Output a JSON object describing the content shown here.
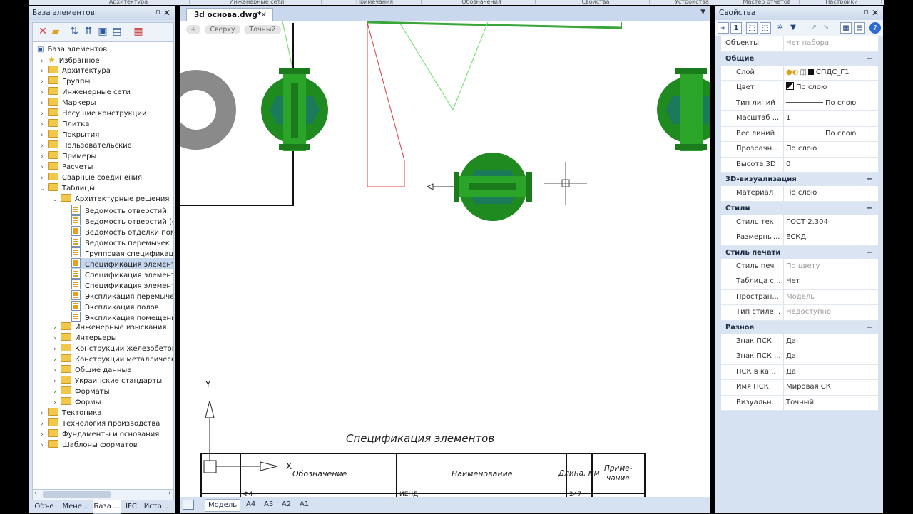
{
  "ribbon_tabs": [
    "Архитектура",
    "Инженерные сети",
    "Примечания",
    "Обозначения",
    "Свойства",
    "Устройства",
    "Мастер отчётов",
    "Настройки"
  ],
  "left_panel": {
    "title": "База элементов",
    "pin": "ᵖ",
    "close": "✕",
    "tree": [
      {
        "label": "База элементов",
        "level": 0,
        "icon": "db",
        "exp": ""
      },
      {
        "label": "Избранное",
        "level": 1,
        "icon": "star",
        "exp": ">"
      },
      {
        "label": "Архитектура",
        "level": 1,
        "icon": "folder",
        "exp": ">"
      },
      {
        "label": "Группы",
        "level": 1,
        "icon": "folder",
        "exp": ">"
      },
      {
        "label": "Инженерные сети",
        "level": 1,
        "icon": "folder",
        "exp": ">"
      },
      {
        "label": "Маркеры",
        "level": 1,
        "icon": "folder",
        "exp": ">"
      },
      {
        "label": "Несущие конструкции",
        "level": 1,
        "icon": "folder",
        "exp": ">"
      },
      {
        "label": "Плитка",
        "level": 1,
        "icon": "folder",
        "exp": ">"
      },
      {
        "label": "Покрытия",
        "level": 1,
        "icon": "folder",
        "exp": ">"
      },
      {
        "label": "Пользовательские",
        "level": 1,
        "icon": "folder",
        "exp": ">"
      },
      {
        "label": "Примеры",
        "level": 1,
        "icon": "folder",
        "exp": ">"
      },
      {
        "label": "Расчеты",
        "level": 1,
        "icon": "folder",
        "exp": ">"
      },
      {
        "label": "Сварные соединения",
        "level": 1,
        "icon": "folder",
        "exp": ">"
      },
      {
        "label": "Таблицы",
        "level": 1,
        "icon": "folder",
        "exp": "v"
      },
      {
        "label": "Архитектурные решения",
        "level": 2,
        "icon": "folder",
        "exp": "v"
      },
      {
        "label": "Ведомость отверстий",
        "level": 3,
        "icon": "table",
        "exp": ""
      },
      {
        "label": "Ведомость отверстий (с",
        "level": 3,
        "icon": "table",
        "exp": ""
      },
      {
        "label": "Ведомость отделки поме",
        "level": 3,
        "icon": "table",
        "exp": ""
      },
      {
        "label": "Ведомость перемычек",
        "level": 3,
        "icon": "table",
        "exp": ""
      },
      {
        "label": "Групповая спецификаци",
        "level": 3,
        "icon": "table",
        "exp": ""
      },
      {
        "label": "Спецификация элементо",
        "level": 3,
        "icon": "table",
        "exp": "",
        "selected": true
      },
      {
        "label": "Спецификация элементо",
        "level": 3,
        "icon": "table",
        "exp": ""
      },
      {
        "label": "Спецификация элементо",
        "level": 3,
        "icon": "table",
        "exp": ""
      },
      {
        "label": "Экспликация перемычек",
        "level": 3,
        "icon": "table",
        "exp": ""
      },
      {
        "label": "Экспликация полов",
        "level": 3,
        "icon": "table",
        "exp": ""
      },
      {
        "label": "Экспликация помещений",
        "level": 3,
        "icon": "table",
        "exp": ""
      },
      {
        "label": "Инженерные изыскания",
        "level": 2,
        "icon": "folder",
        "exp": ">"
      },
      {
        "label": "Интерьеры",
        "level": 2,
        "icon": "folder",
        "exp": ">"
      },
      {
        "label": "Конструкции железобетонны",
        "level": 2,
        "icon": "folder",
        "exp": ">"
      },
      {
        "label": "Конструкции металлические",
        "level": 2,
        "icon": "folder",
        "exp": ">"
      },
      {
        "label": "Общие данные",
        "level": 2,
        "icon": "folder",
        "exp": ">"
      },
      {
        "label": "Украинские стандарты",
        "level": 2,
        "icon": "folder",
        "exp": ">"
      },
      {
        "label": "Форматы",
        "level": 2,
        "icon": "folder",
        "exp": ">"
      },
      {
        "label": "Формы",
        "level": 2,
        "icon": "folder",
        "exp": ">"
      },
      {
        "label": "Тектоника",
        "level": 1,
        "icon": "folder",
        "exp": ">"
      },
      {
        "label": "Технология производства",
        "level": 1,
        "icon": "folder",
        "exp": ">"
      },
      {
        "label": "Фундаменты и основания",
        "level": 1,
        "icon": "folder",
        "exp": ">"
      },
      {
        "label": "Шаблоны форматов",
        "level": 1,
        "icon": "folder",
        "exp": ">"
      }
    ],
    "tabs": [
      "Объе",
      "Мене...",
      "База ...",
      "IFC",
      "Исто..."
    ],
    "active_tab": 2
  },
  "document": {
    "tab": "3d основа.dwg*",
    "view_buttons": [
      "+",
      "Сверху",
      "Точный"
    ],
    "drawing": {
      "table_title": "Спецификация элементов",
      "headers": [
        "Обозначение",
        "Наименование",
        "Длина, мм",
        "Приме-",
        "чание"
      ],
      "partial_cells": [
        "Ф4",
        "ИЕНД",
        "247"
      ],
      "axis_y": "Y",
      "axis_x": "X"
    },
    "layout_tabs": [
      "Модель",
      "А4",
      "А3",
      "А2",
      "А1"
    ],
    "active_layout": 0
  },
  "properties": {
    "title": "Свойства",
    "objects_label": "Объекты",
    "objects_value": "Нет набора",
    "sections": [
      {
        "name": "Общие",
        "rows": [
          {
            "k": "Слой",
            "v": "СПДС_Г1",
            "icons": true
          },
          {
            "k": "Цвет",
            "v": "По слою",
            "swatch": true
          },
          {
            "k": "Тип линий",
            "v": "По слою",
            "line": true
          },
          {
            "k": "Масштаб ...",
            "v": "1"
          },
          {
            "k": "Вес линий",
            "v": "По слою",
            "line": true
          },
          {
            "k": "Прозрачн...",
            "v": "По слою"
          },
          {
            "k": "Высота 3D",
            "v": "0"
          }
        ]
      },
      {
        "name": "3D-визуализация",
        "rows": [
          {
            "k": "Материал",
            "v": "По слою"
          }
        ]
      },
      {
        "name": "Стили",
        "rows": [
          {
            "k": "Стиль тек",
            "v": "ГОСТ 2.304"
          },
          {
            "k": "Размерны...",
            "v": "ЕСКД"
          }
        ]
      },
      {
        "name": "Стиль печати",
        "rows": [
          {
            "k": "Стиль печ",
            "v": "По цвету",
            "disabled": true
          },
          {
            "k": "Таблица с...",
            "v": "Нет"
          },
          {
            "k": "Простран...",
            "v": "Модель",
            "disabled": true
          },
          {
            "k": "Тип стиле...",
            "v": "Недоступно",
            "disabled": true
          }
        ]
      },
      {
        "name": "Разное",
        "rows": [
          {
            "k": "Знак ПСК",
            "v": "Да"
          },
          {
            "k": "Знак ПСК ...",
            "v": "Да"
          },
          {
            "k": "ПСК в ка...",
            "v": "Да"
          },
          {
            "k": "Имя ПСК",
            "v": "Мировая СК"
          },
          {
            "k": "Визуальн...",
            "v": "Точный"
          }
        ]
      }
    ],
    "collapse_symbol": "−"
  }
}
